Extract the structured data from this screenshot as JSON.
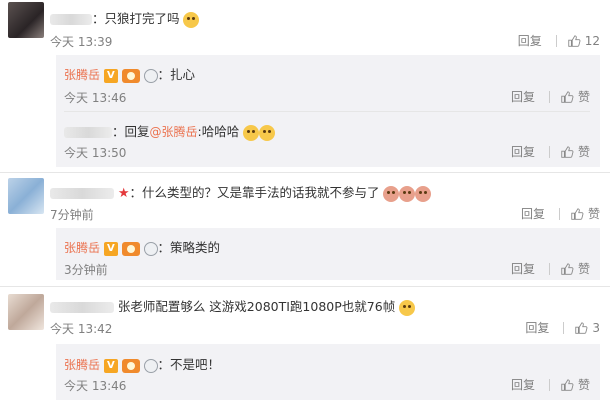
{
  "brand": {
    "name_color": "#eb7350",
    "link_color": "#eb7350"
  },
  "threads": [
    {
      "comment_text": "：只狼打完了吗",
      "emoji": "cat-face-emoji",
      "time": "今天 13:39",
      "reply_label": "回复",
      "like_count": "12",
      "replies": [
        {
          "author": "张腾岳",
          "text": "：扎心",
          "time": "今天 13:46",
          "reply_label": "回复",
          "like_label": "赞"
        },
        {
          "prefix": "：回复",
          "mention": "@张腾岳",
          "text": ":哈哈哈",
          "time": "今天 13:50",
          "reply_label": "回复",
          "like_label": "赞"
        }
      ]
    },
    {
      "comment_text": "：什么类型的？又是靠手法的话我就不参与了",
      "time": "7分钟前",
      "reply_label": "回复",
      "like_label": "赞",
      "replies": [
        {
          "author": "张腾岳",
          "text": "：策略类的",
          "time": "3分钟前",
          "reply_label": "回复",
          "like_label": "赞"
        }
      ]
    },
    {
      "comment_text": "张老师配置够么 这游戏2080TI跑1080P也就76帧",
      "time": "今天 13:42",
      "reply_label": "回复",
      "like_count": "3",
      "replies": [
        {
          "author": "张腾岳",
          "text": "：不是吧！",
          "time": "今天 13:46",
          "reply_label": "回复",
          "like_label": "赞"
        }
      ]
    }
  ]
}
